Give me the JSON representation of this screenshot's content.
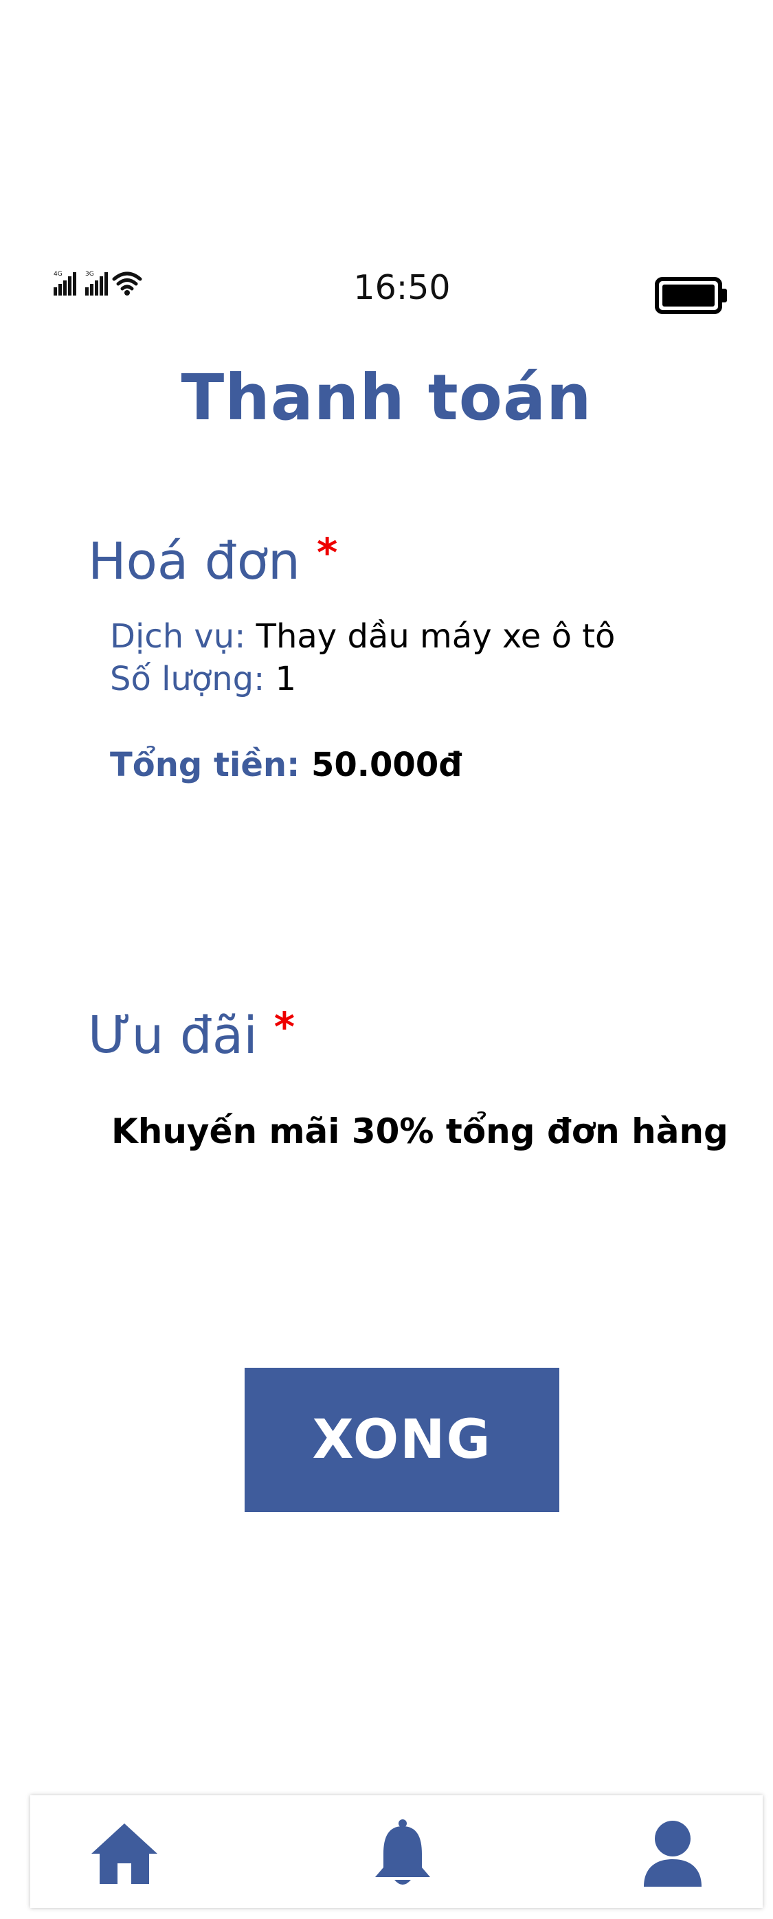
{
  "status_bar": {
    "time": "16:50",
    "signal_label_1": "4G",
    "signal_label_2": "3G",
    "icons": [
      "signal-bars-icon",
      "signal-bars-icon",
      "wifi-icon",
      "battery-icon"
    ]
  },
  "header": {
    "title": "Thanh toán"
  },
  "invoice": {
    "title": "Hoá đơn",
    "required_mark": "*",
    "service_label": "Dịch vụ:",
    "service_value": "Thay dầu máy xe ô tô",
    "quantity_label": "Số lượng:",
    "quantity_value": "1",
    "total_label": "Tổng tiền:",
    "total_value": "50.000đ"
  },
  "offer": {
    "title": "Ưu đãi",
    "required_mark": "*",
    "text": "Khuyến mãi 30% tổng đơn hàng"
  },
  "actions": {
    "done_label": "XONG"
  },
  "bottom_nav": {
    "items": [
      "home-icon",
      "bell-icon",
      "user-icon"
    ]
  },
  "colors": {
    "primary": "#3f5c9c",
    "required": "#ee0000",
    "text": "#000000",
    "background": "#ffffff"
  }
}
